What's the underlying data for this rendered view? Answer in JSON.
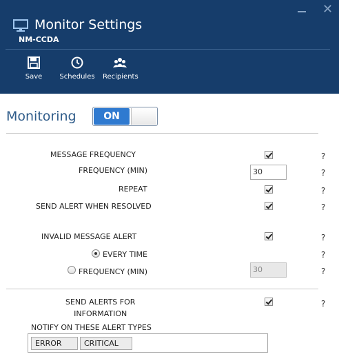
{
  "window": {
    "title": "Monitor Settings",
    "subtitle": "NM-CCDA",
    "minimize_icon": "minimize-icon",
    "close_icon": "close-icon",
    "close_glyph": "✕"
  },
  "toolbar": {
    "save_label": "Save",
    "schedules_label": "Schedules",
    "recipients_label": "Recipients"
  },
  "monitoring": {
    "label": "Monitoring",
    "toggle_label": "ON",
    "enabled": true
  },
  "settings": {
    "message_frequency": {
      "label": "MESSAGE FREQUENCY",
      "checked": true
    },
    "frequency_min": {
      "label": "FREQUENCY (MIN)",
      "value": "30"
    },
    "repeat": {
      "label": "REPEAT",
      "checked": true
    },
    "send_alert_resolved": {
      "label": "SEND ALERT WHEN RESOLVED",
      "checked": true
    },
    "invalid_message_alert": {
      "label": "INVALID MESSAGE ALERT",
      "checked": true
    },
    "every_time": {
      "label": "EVERY TIME",
      "selected": true
    },
    "invalid_frequency": {
      "label": "FREQUENCY (MIN)",
      "value": "30",
      "selected": false
    },
    "send_alerts_info": {
      "label_line1": "SEND ALERTS FOR",
      "label_line2": "INFORMATION",
      "checked": true
    },
    "notify_label": "NOTIFY ON THESE ALERT TYPES",
    "alert_types": [
      "ERROR",
      "CRITICAL"
    ]
  },
  "help_glyph": "?",
  "colors": {
    "header_bg": "#163d6b",
    "accent": "#2f7ad0",
    "monitoring_label": "#2f5c8a"
  }
}
